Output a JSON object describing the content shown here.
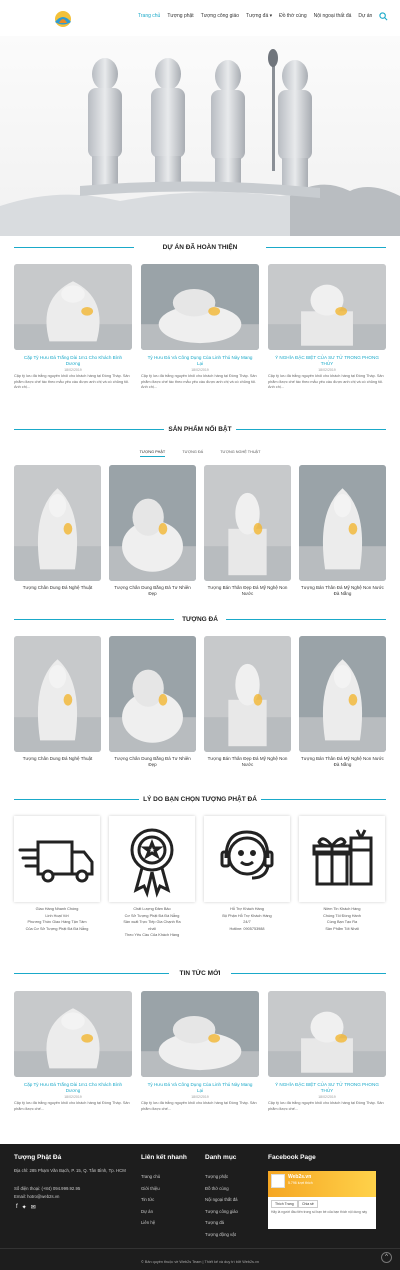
{
  "nav": {
    "items": [
      "Trang chủ",
      "Tượng phật",
      "Tượng công giáo",
      "Tượng đá",
      "Đồ thờ cúng",
      "Nội ngoại thất đá",
      "Dự án"
    ],
    "active_color": "#1aa9c9"
  },
  "sections": {
    "projects": "DỰ ÁN ĐÃ HOÀN THIỆN",
    "featured": "SẢN PHẨM NỔI BẬT",
    "stone": "TƯỢNG ĐÁ",
    "why": "LÝ DO BẠN CHỌN TƯỢNG PHẬT ĐÁ",
    "news": "TIN TỨC MỚI"
  },
  "tabs": [
    "TƯỢNG PHẬT",
    "TƯỢNG ĐÁ",
    "TƯỢNG NGHỆ THUẬT"
  ],
  "projects": [
    {
      "title": "Cặp Tỳ Hưu Đá Trắng Dài 1m1 Cho Khách Bình Dương",
      "date": "18/02/2019",
      "excerpt": "Cặp tỳ lưu đá trắng nguyên khối cho khách hàng tại Đồng Tháp. Sản phẩm được chế tác theo mẫu yêu cầu được anh chị và có chủng tôi. Anh chị..."
    },
    {
      "title": "Tỳ Hưu Đá Và Công Dụng Của Linh Thú Này Mang Lại",
      "date": "18/02/2019",
      "excerpt": "Cặp tỳ lưu đá trắng nguyên khối cho khách hàng tại Đồng Tháp. Sản phẩm được chế tác theo mẫu yêu cầu được anh chị và có chủng tôi. Anh chị..."
    },
    {
      "title": "Ý NGHĨA ĐẶC BIỆT CỦA SƯ TỬ TRONG PHONG THỦY",
      "date": "18/02/2019",
      "excerpt": "Cặp tỳ lưu đá trắng nguyên khối cho khách hàng tại Đồng Tháp. Sản phẩm được chế tác theo mẫu yêu cầu được anh chị và có chủng tôi. Anh chị..."
    }
  ],
  "products": [
    {
      "title": "Tượng Chân Dung Đá Nghệ Thuật"
    },
    {
      "title": "Tượng Chân Dung Bằng Đá Tư Nhiên Đẹp"
    },
    {
      "title": "Tượng Bán Thân Đẹp Đá Mỹ Nghệ Non Nước"
    },
    {
      "title": "Tượng Bán Thân Đá Mỹ Nghệ Non Nước Đà Nẵng"
    }
  ],
  "stone_products": [
    {
      "title": "Tượng Chân Dung Đá Nghệ Thuật"
    },
    {
      "title": "Tượng Chân Dung Bằng Đá Tư Nhiên Đẹp"
    },
    {
      "title": "Tượng Bán Thân Đẹp Đá Mỹ Nghệ Non Nước"
    },
    {
      "title": "Tượng Bán Thân Đá Mỹ Nghệ Non Nước Đà Nẵng"
    }
  ],
  "reasons": [
    {
      "icon": "delivery-truck-icon",
      "lines": [
        "Giao Hàng Nhanh Chóng",
        "Linh Hoạt Với",
        "Phương Thức Giao Hàng Tận Tâm",
        "Của Cơ Sở Tượng Phật Đá Đà Nẵng"
      ]
    },
    {
      "icon": "award-badge-icon",
      "lines": [
        "Chất Lượng Đảm Bảo",
        "Cơ Sở Tượng Phật Đá Đà Nẵng",
        "Sản xuất Trực Tiếp Gia Chạnh Ra",
        "nhất",
        "Theo Yêu Cầu Của Khách Hàng"
      ]
    },
    {
      "icon": "support-agent-icon",
      "lines": [
        "Hỗ Trợ Khách Hàng",
        "Bộ Phận Hỗ Trợ Khách Hàng",
        "24/7",
        "Hotline: 0905753988"
      ]
    },
    {
      "icon": "gift-icon",
      "lines": [
        "Niềm Tin Khách Hàng",
        "Chúng Tôi Đồng Hành",
        "Cùng Bạn Tạo Ra",
        "Sản Phẩm Tốt Nhất"
      ]
    }
  ],
  "news": [
    {
      "title": "Cặp Tỳ Hưu Đá Trắng Dài 1m1 Cho Khách Bình Dương",
      "date": "18/02/2019",
      "excerpt": "Cặp tỳ lưu đá trắng nguyên khối cho khách hàng tại Đồng Tháp. Sản phẩm được chế..."
    },
    {
      "title": "Tỳ Hưu Đá Và Công Dụng Của Linh Thú Này Mang Lại",
      "date": "18/02/2019",
      "excerpt": "Cặp tỳ lưu đá trắng nguyên khối cho khách hàng tại Đồng Tháp. Sản phẩm được chế..."
    },
    {
      "title": "Ý NGHĨA ĐẶC BIỆT CỦA SƯ TỬ TRONG PHONG THỦY",
      "date": "18/02/2019",
      "excerpt": "Cặp tỳ lưu đá trắng nguyên khối cho khách hàng tại Đồng Tháp. Sản phẩm được chế..."
    }
  ],
  "footer": {
    "brand": "Tượng Phật Đá",
    "address": "Địa chỉ: 285 Phạm Văn Bạch, P. 15, Q. Tân Bình, Tp. HCM",
    "phone": "Số điện thoại: (+84) 094.999.92.95",
    "email": "Email: hotro@web2s.vn",
    "links_title": "Liên kết nhanh",
    "links": [
      "Trang chủ",
      "Giới thiệu",
      "Tin tức",
      "Dự án",
      "Liên hệ"
    ],
    "cat_title": "Danh mục",
    "cats": [
      "Tượng phật",
      "Đồ thờ cúng",
      "Nội ngoại thất đá",
      "Tượng công giáo",
      "Tượng đá",
      "Tượng động vật"
    ],
    "fb_title": "Facebook Page",
    "fb_name": "Web2s.vn",
    "fb_likes": "5.796 lượt thích",
    "fb_like_btn": "Thích Trang",
    "fb_share": "Chia sẻ",
    "fb_text": "Hãy là người đầu tiên trong số bạn bè của bạn thích nội dung này",
    "copyright": "© Bản quyền thuộc về Web2s Team | Thiết kế và duy trì bởi Web2s.vn"
  }
}
